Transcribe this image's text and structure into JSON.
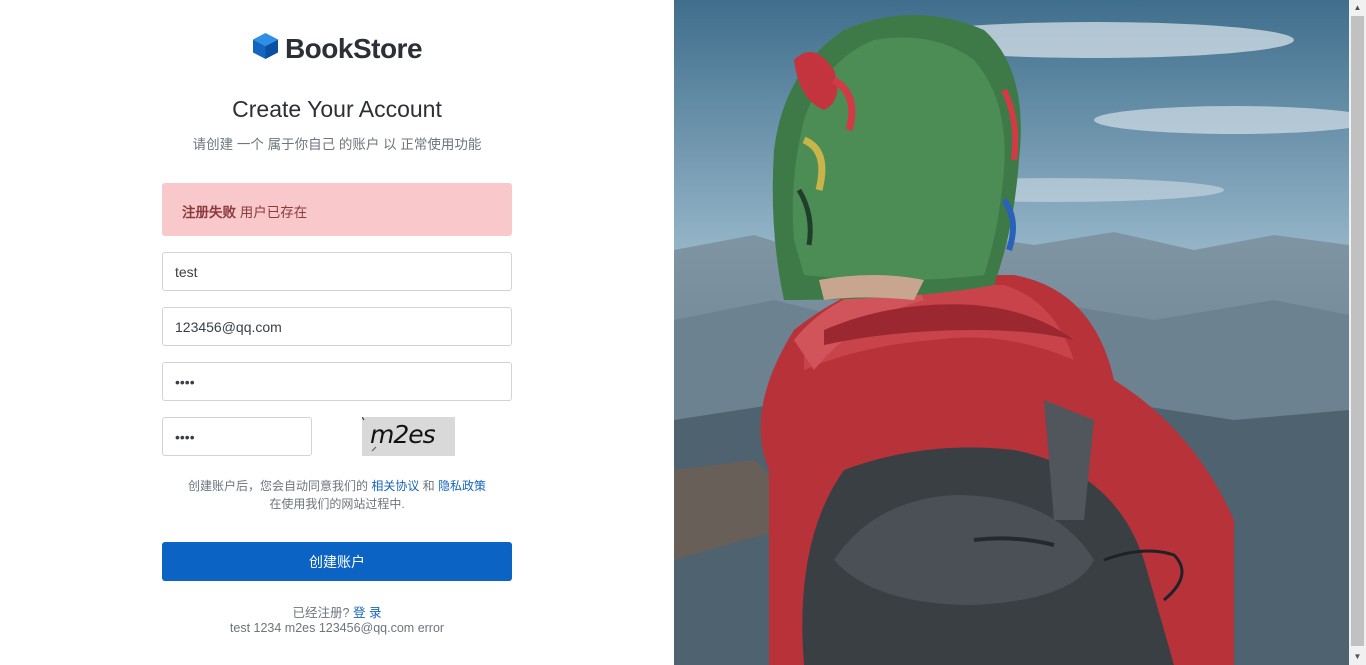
{
  "brand": {
    "name": "BookStore",
    "logo_icon": "cube-icon",
    "accent": "#0b63c4"
  },
  "heading": {
    "title": "Create Your Account",
    "subtitle": "请创建 一个 属于你自己 的账户 以 正常使用功能"
  },
  "alert": {
    "strong": "注册失败",
    "message": " 用户已存在",
    "color": "#f8c8cb"
  },
  "form": {
    "username": "test",
    "email": "123456@qq.com",
    "password": "1234",
    "captcha_input": "1234",
    "captcha_text": "m2es"
  },
  "terms": {
    "prefix": "创建账户后，您会自动同意我们的 ",
    "agreement_link": "相关协议",
    "and": " 和 ",
    "privacy_link": "隐私政策",
    "suffix": "在使用我们的网站过程中."
  },
  "submit_label": "创建账户",
  "login": {
    "prompt": "已经注册? ",
    "link": "登 录"
  },
  "debug_text": "test 1234 m2es 123456@qq.com error"
}
